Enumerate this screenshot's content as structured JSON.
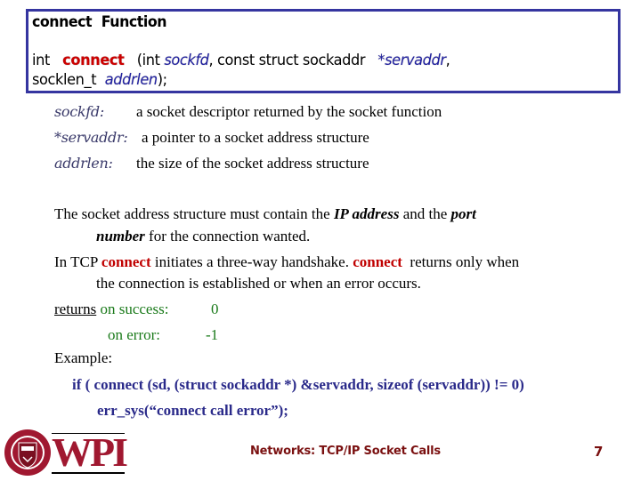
{
  "box": {
    "title": "connect  Function",
    "signature": {
      "ret": "int",
      "func": "connect",
      "open": "(int",
      "p1": "sockfd",
      "mid": ", const struct sockaddr",
      "p2": "*servaddr",
      "comma": ",",
      "line2_type": "socklen_t",
      "p3": "addrlen",
      "close": ");"
    }
  },
  "definitions": [
    {
      "term": "sockfd:",
      "desc": "a socket descriptor returned by the socket function"
    },
    {
      "term": "*servaddr:",
      "desc": "a pointer to a socket address structure"
    },
    {
      "term": "addrlen:",
      "desc": "the size of the socket address structure"
    }
  ],
  "para1": {
    "a": "The socket address structure must contain the ",
    "b": "IP address",
    "c": " and the ",
    "d": "port",
    "e": "number",
    "f": " for the connection wanted."
  },
  "para2": {
    "a": "In TCP ",
    "b": "connect",
    "c": " initiates a three-way handshake. ",
    "d": "connect",
    "e": "  returns only when",
    "f": "the connection is established or when an error occurs."
  },
  "returns": {
    "label": "returns",
    "success_label": "on success:",
    "success_value": "0",
    "error_label": "on error:",
    "error_value": "-1"
  },
  "example": {
    "label": "Example:",
    "line1": "if ( connect (sd, (struct sockaddr *) &servaddr, sizeof (servaddr)) != 0)",
    "line2": "err_sys(“connect call error”);"
  },
  "footer": {
    "logo_text": "WPI",
    "logo_icon": "wpi-seal-icon",
    "title": "Networks: TCP/IP Socket Calls",
    "page": "7"
  },
  "colors": {
    "box_border": "#3535a0",
    "keyword_red": "#cc0000",
    "param_blue": "#1f1fa0",
    "green": "#1a7a1a",
    "footer": "#7a1010",
    "wpi_red": "#a01830"
  }
}
